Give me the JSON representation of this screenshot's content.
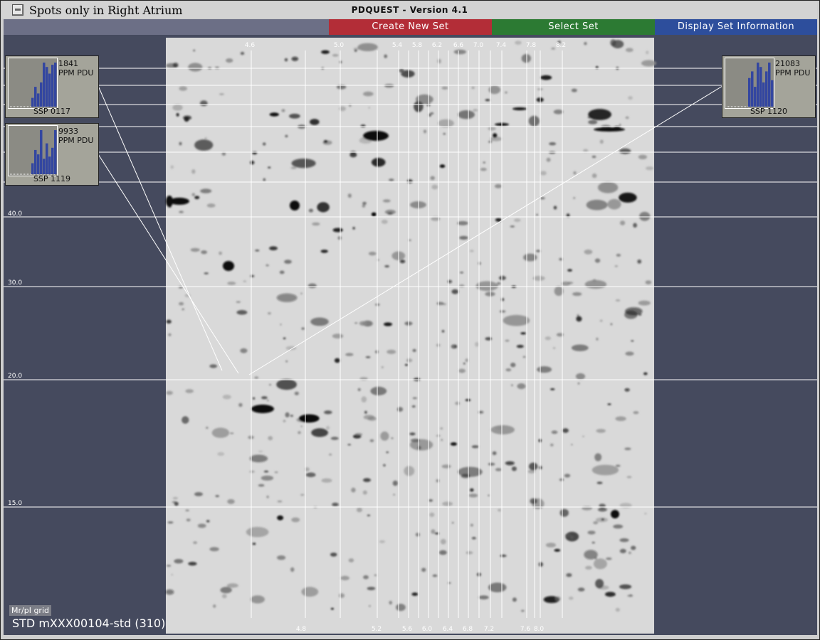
{
  "window": {
    "title": "Spots only in Right Atrium",
    "app_title": "PDQUEST - Version 4.1"
  },
  "toolbar": {
    "create_label": "Create New Set",
    "select_label": "Select Set",
    "info_label": "Display Set Information",
    "colors": {
      "create": "#b32d37",
      "select": "#2c7a33",
      "info": "#2d4e9c"
    }
  },
  "gel": {
    "pi_top_labels": [
      "4.6",
      "5.0",
      "5.4",
      "5.8",
      "6.2",
      "6.6",
      "7.0",
      "7.4",
      "7.8",
      "8.2"
    ],
    "pi_bottom_labels": [
      "4.8",
      "5.2",
      "5.6",
      "6.0",
      "6.4",
      "6.8",
      "7.2",
      "7.6",
      "8.0"
    ],
    "mr_labels": [
      "40.0",
      "30.0",
      "20.0",
      "15.0"
    ]
  },
  "panels": [
    {
      "value": "1841",
      "unit": "PPM PDU",
      "ssp": "SSP 0117",
      "bars": [
        0.2,
        0.45,
        0.3,
        0.55,
        1.0,
        0.9,
        0.75,
        0.95,
        1.0,
        0.8
      ]
    },
    {
      "value": "9933",
      "unit": "PPM PDU",
      "ssp": "SSP 1119",
      "bars": [
        0.25,
        0.55,
        0.45,
        1.0,
        0.35,
        0.7,
        0.4,
        0.6,
        1.0,
        0.85
      ]
    },
    {
      "value": "21083",
      "unit": "PPM PDU",
      "ssp": "SSP 1120",
      "bars": [
        0.65,
        0.8,
        0.45,
        1.0,
        0.9,
        0.55,
        0.8,
        1.0,
        0.6,
        0.7
      ]
    }
  ],
  "footer": {
    "grid_label": "Mr/pI grid",
    "status": "STD mXXX00104-std (310)"
  }
}
